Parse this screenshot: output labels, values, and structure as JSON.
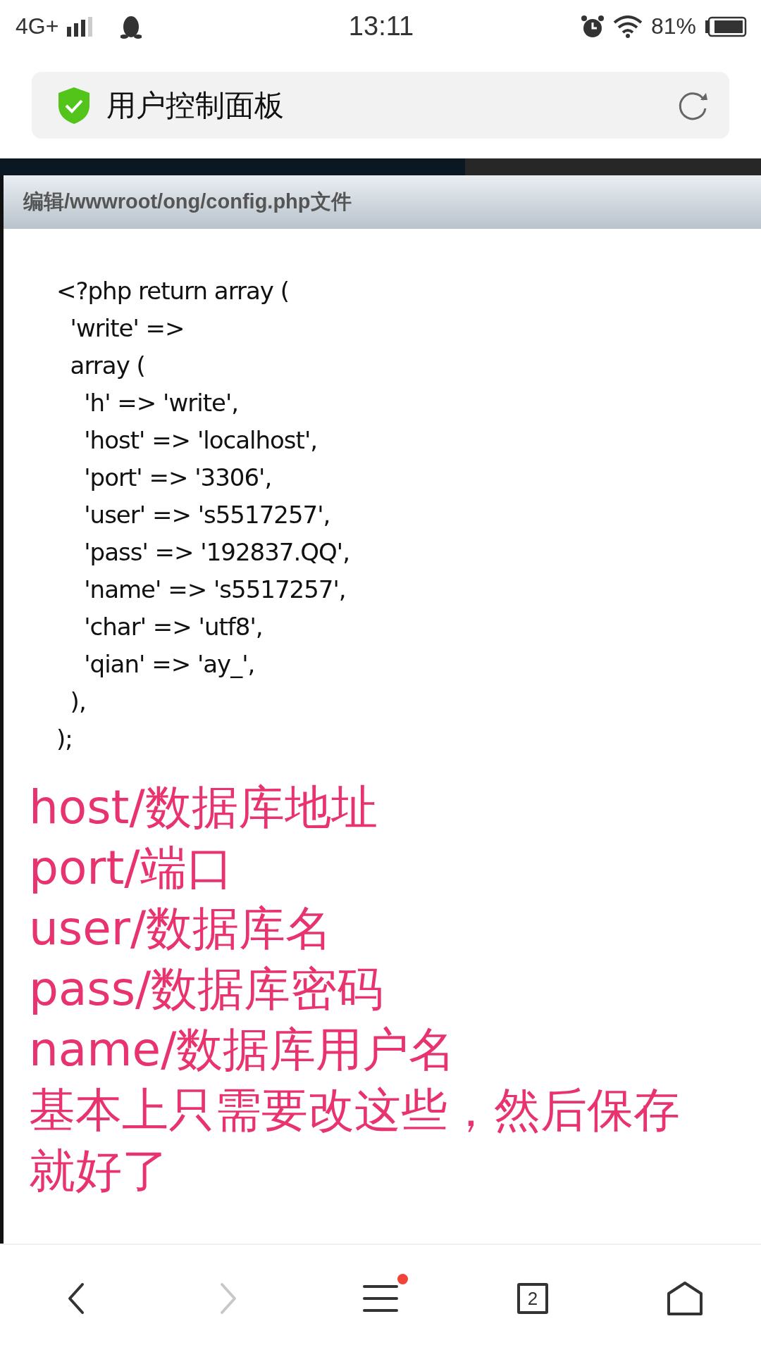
{
  "status_bar": {
    "network": "4G+",
    "time": "13:11",
    "battery": "81%"
  },
  "address_bar": {
    "title": "用户控制面板",
    "secure": true
  },
  "editor": {
    "title": "编辑/wwwroot/ong/config.php文件",
    "code_lines": [
      "<?php return array (",
      "  'write' =>",
      "  array (",
      "    'h' => 'write',",
      "    'host' => 'localhost',",
      "    'port' => '3306',",
      "    'user' => 's5517257',",
      "    'pass' => '192837.QQ',",
      "    'name' => 's5517257',",
      "    'char' => 'utf8',",
      "    'qian' => 'ay_',",
      "  ),",
      ");"
    ]
  },
  "notes": [
    "host/数据库地址",
    "port/端口",
    "user/数据库名",
    "pass/数据库密码",
    "name/数据库用户名",
    "基本上只需要改这些，然后保存就好了"
  ],
  "bottom_nav": [
    {
      "kind": "back",
      "disabled": false
    },
    {
      "kind": "forward",
      "disabled": true
    },
    {
      "kind": "menu",
      "disabled": false,
      "badge": true
    },
    {
      "kind": "tabs",
      "disabled": false,
      "label": "2"
    },
    {
      "kind": "home",
      "disabled": false
    }
  ]
}
